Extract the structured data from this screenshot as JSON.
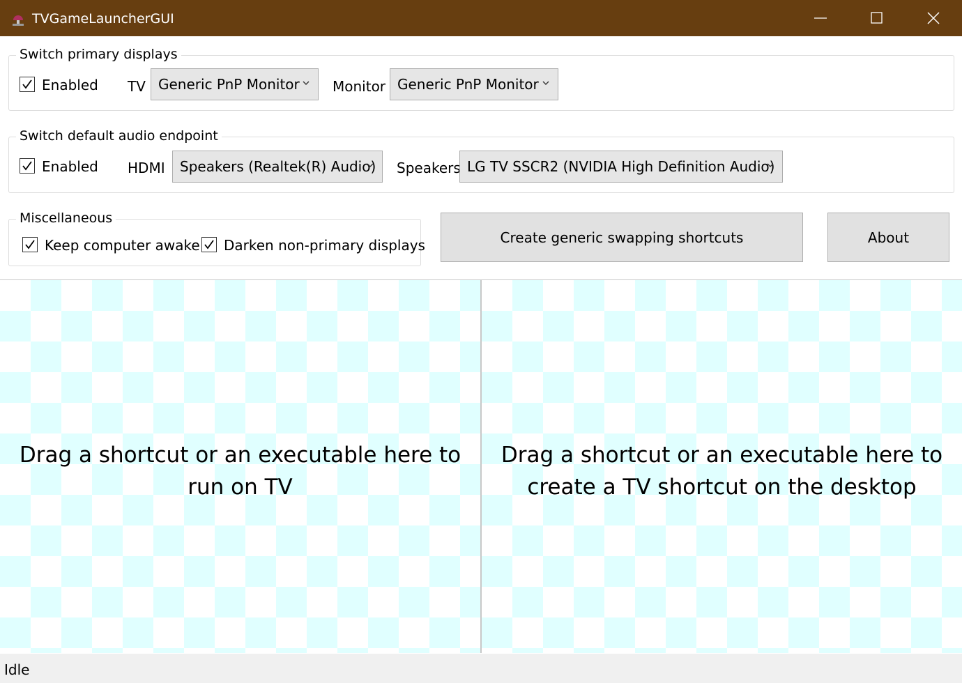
{
  "window": {
    "title": "TVGameLauncherGUI",
    "icon": "lamp-icon"
  },
  "primary_displays": {
    "legend": "Switch primary displays",
    "enabled_label": "Enabled",
    "enabled_checked": true,
    "tv_label": "TV",
    "tv_value": "Generic PnP Monitor",
    "monitor_label": "Monitor",
    "monitor_value": "Generic PnP Monitor"
  },
  "audio_endpoint": {
    "legend": "Switch default audio endpoint",
    "enabled_label": "Enabled",
    "enabled_checked": true,
    "hdmi_label": "HDMI",
    "hdmi_value": "Speakers (Realtek(R) Audio)",
    "speakers_label": "Speakers",
    "speakers_value": "LG TV SSCR2 (NVIDIA High Definition Audio)"
  },
  "misc": {
    "legend": "Miscellaneous",
    "keep_awake_label": "Keep computer awake",
    "keep_awake_checked": true,
    "darken_label": "Darken non-primary displays",
    "darken_checked": true
  },
  "buttons": {
    "create_shortcuts": "Create generic swapping shortcuts",
    "about": "About"
  },
  "dropzones": {
    "run_on_tv": "Drag a shortcut or an executable here to run on TV",
    "create_shortcut": "Drag a shortcut or an executable here to create a TV shortcut on the desktop"
  },
  "status": "Idle",
  "colors": {
    "titlebar": "#673e10",
    "checker": "#e0ffff"
  }
}
